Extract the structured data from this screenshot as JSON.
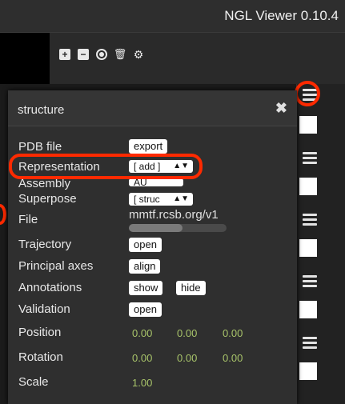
{
  "app": {
    "title": "NGL Viewer 0.10.4"
  },
  "toolbar": {
    "icons": [
      "plus-icon",
      "minus-icon",
      "target-icon",
      "trash-icon",
      "gears-icon"
    ],
    "plus": "+",
    "minus": "−",
    "trash": "🗑",
    "gears": "⚙"
  },
  "panel": {
    "title": "structure",
    "close": "✖",
    "rows": {
      "pdb_file": {
        "label": "PDB file",
        "button": "export"
      },
      "representation": {
        "label": "Representation",
        "select": "[ add ]"
      },
      "assembly": {
        "label": "Assembly",
        "select": "AU"
      },
      "superpose": {
        "label": "Superpose",
        "select": "[ struc"
      },
      "file": {
        "label": "File",
        "value": "mmtf.rcsb.org/v1",
        "progress": 0.55
      },
      "trajectory": {
        "label": "Trajectory",
        "button": "open"
      },
      "principal_axes": {
        "label": "Principal axes",
        "button": "align"
      },
      "annotations": {
        "label": "Annotations",
        "button_show": "show",
        "button_hide": "hide"
      },
      "validation": {
        "label": "Validation",
        "button": "open"
      },
      "position": {
        "label": "Position",
        "x": "0.00",
        "y": "0.00",
        "z": "0.00"
      },
      "rotation": {
        "label": "Rotation",
        "x": "0.00",
        "y": "0.00",
        "z": "0.00"
      },
      "scale": {
        "label": "Scale",
        "value": "1.00"
      }
    },
    "select_arrow": "▲▼"
  },
  "colors": {
    "highlight": "#ff2a00",
    "value_green": "#a8c46a"
  }
}
